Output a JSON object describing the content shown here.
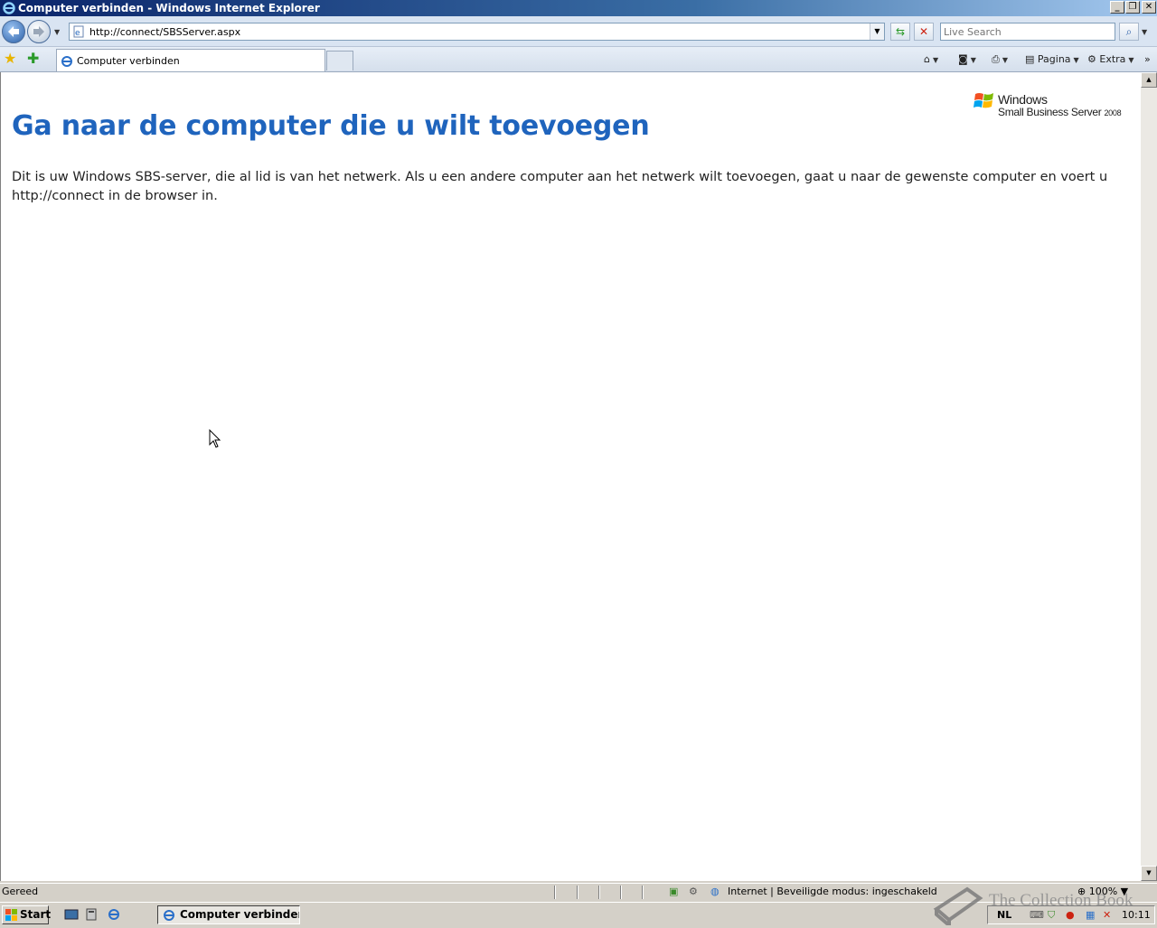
{
  "window": {
    "title": "Computer verbinden - Windows Internet Explorer"
  },
  "nav": {
    "address_url": "http://connect/SBSServer.aspx",
    "search_placeholder": "Live Search"
  },
  "tabs": [
    {
      "label": "Computer verbinden"
    }
  ],
  "commandbar": {
    "page_label": "Pagina",
    "tools_label": "Extra"
  },
  "page": {
    "logo_line1": "Windows",
    "logo_line2": "Small Business Server",
    "logo_year": "2008",
    "heading": "Ga naar de computer die u wilt toevoegen",
    "paragraph": "Dit is uw Windows SBS-server, die al lid is van het netwerk. Als u een andere computer aan het netwerk wilt toevoegen, gaat u naar de gewenste computer en voert u http://connect in de browser in."
  },
  "statusbar": {
    "status_text": "Gereed",
    "zone_text": "Internet | Beveiligde modus: ingeschakeld",
    "zoom": "100%"
  },
  "taskbar": {
    "start_label": "Start",
    "task_label": "Computer verbinden ...",
    "language": "NL",
    "clock": "10:11"
  },
  "watermark": {
    "text": "The Collection Book"
  },
  "colors": {
    "heading": "#1f64bd",
    "titlebar": "#0a246a"
  }
}
